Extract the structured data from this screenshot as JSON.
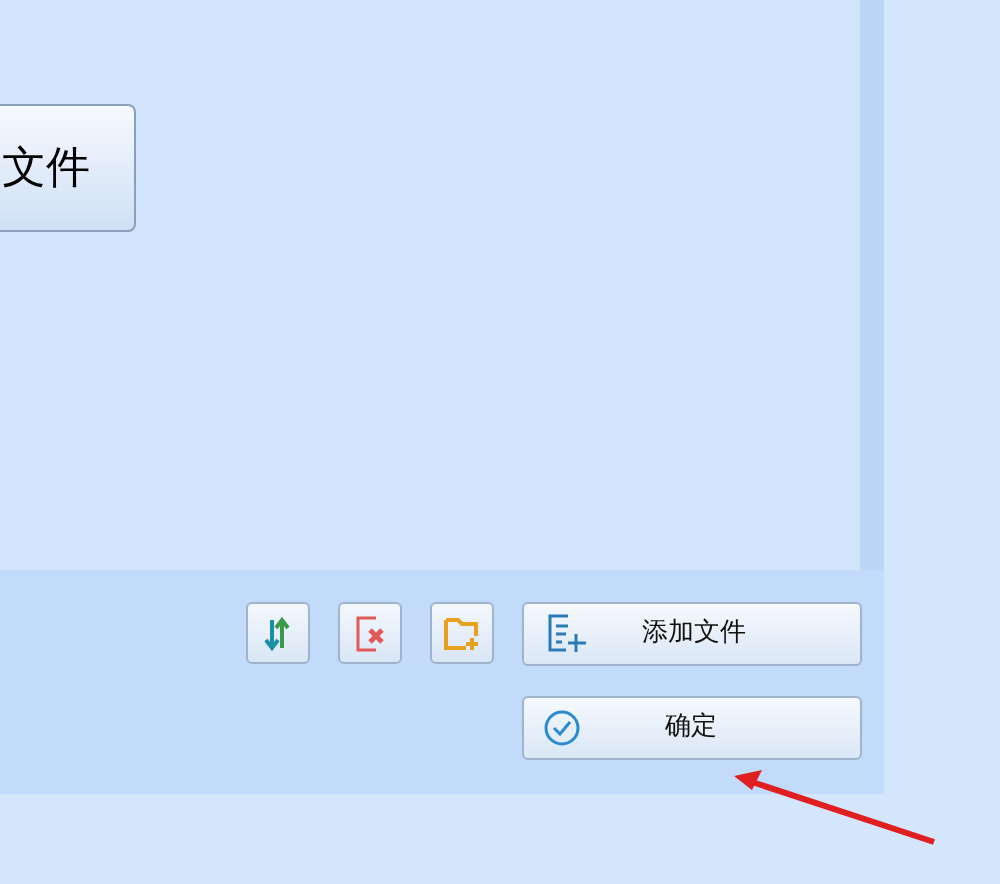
{
  "main_button": {
    "label": "文件"
  },
  "toolbar": {
    "buttons": [
      {
        "label": "添加文件"
      },
      {
        "label": "确定"
      }
    ]
  }
}
